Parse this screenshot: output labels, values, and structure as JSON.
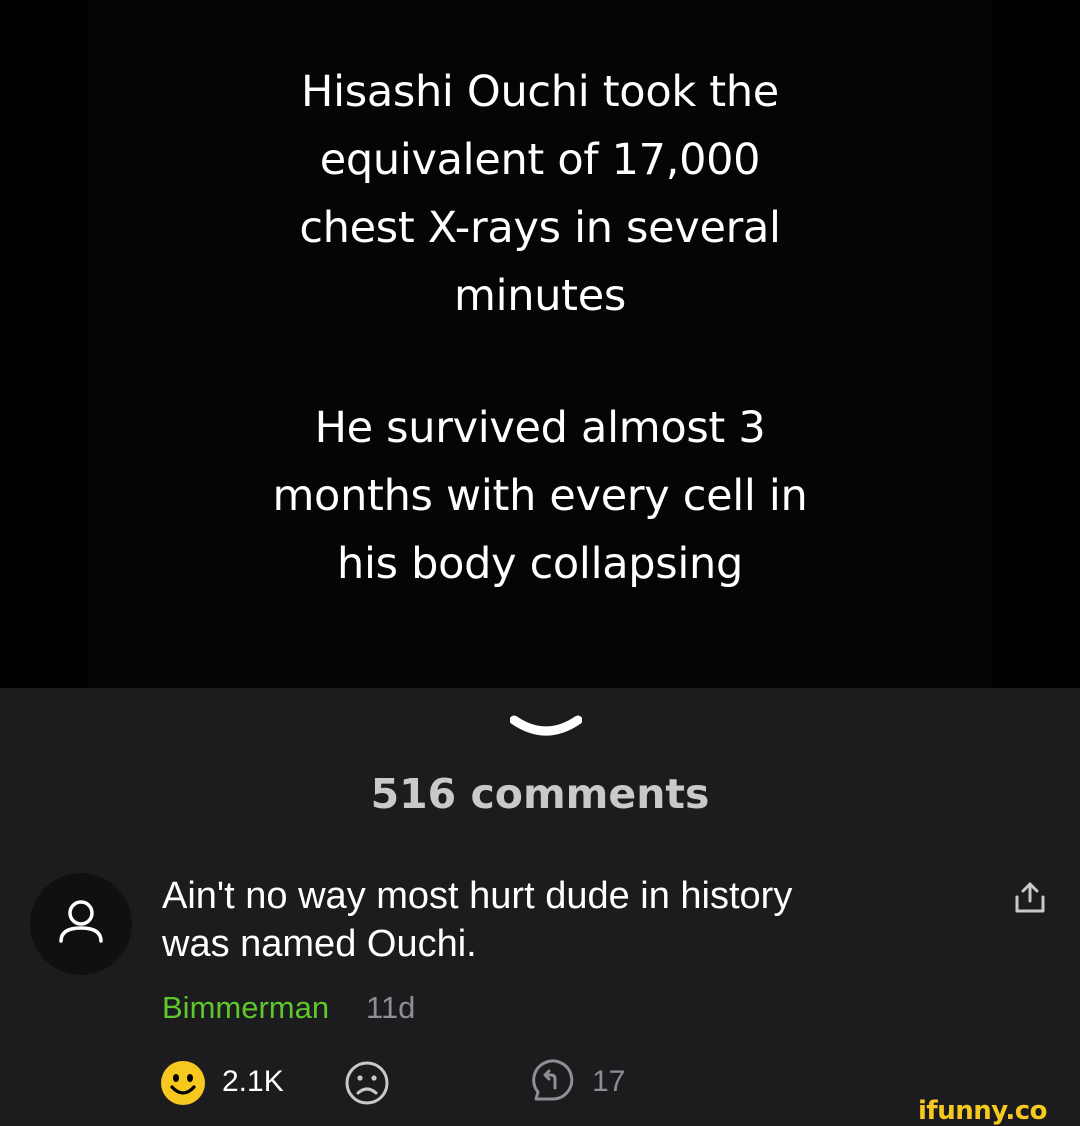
{
  "meme": {
    "paragraph1": "Hisashi Ouchi took the\nequivalent of 17,000\nchest X-rays in several\nminutes",
    "paragraph2": "He survived almost 3\nmonths with every cell in\nhis body collapsing"
  },
  "comments_section": {
    "count_label": "516 comments",
    "collapse_icon": "chevron-down-icon"
  },
  "comment": {
    "text": "Ain't no way most hurt dude in history\nwas named Ouchi.",
    "author": "Bimmerman",
    "author_color": "#5ec72c",
    "age": "11d",
    "smiles": "2.1K",
    "replies": "17",
    "icons": {
      "avatar": "user-placeholder-icon",
      "share": "share-icon",
      "smile": "smile-icon",
      "unsmile": "frown-icon",
      "reply": "reply-icon"
    }
  },
  "watermark": "ifunny.co",
  "colors": {
    "panel_background": "#1c1c1e",
    "smile_yellow": "#f7c81e",
    "muted_text": "#8e8e93"
  }
}
